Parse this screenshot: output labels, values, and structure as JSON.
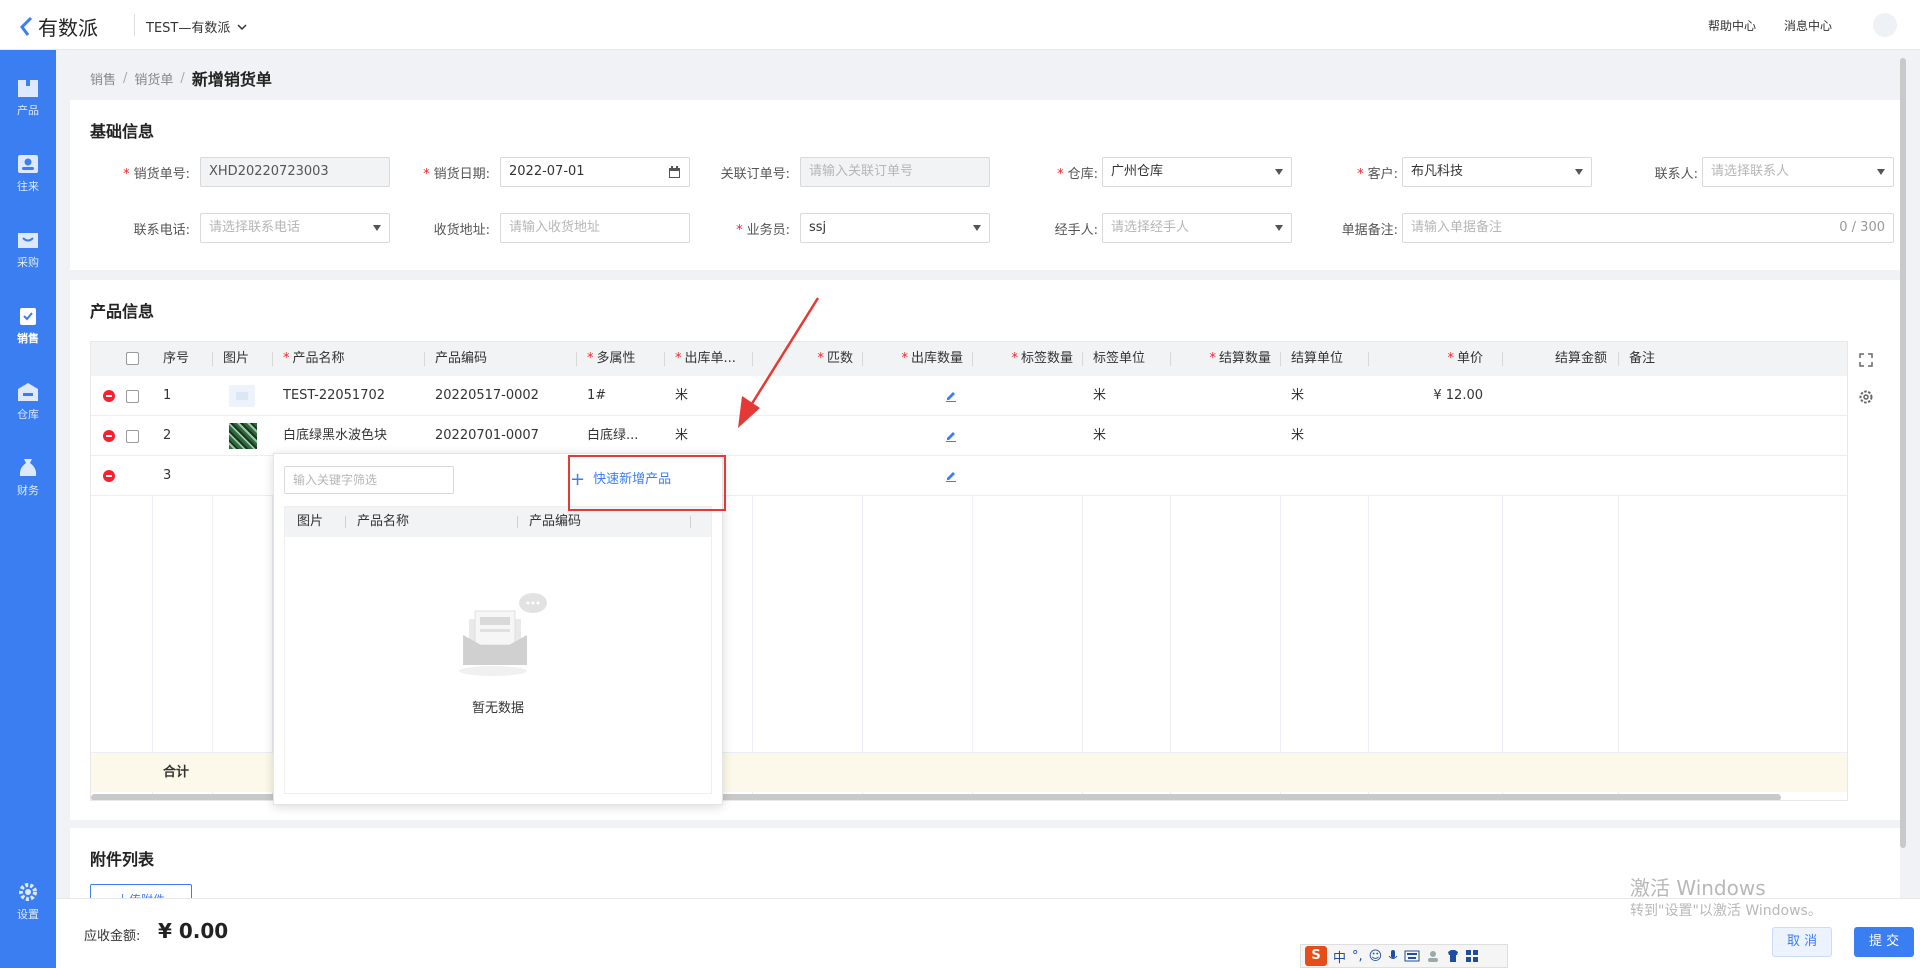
{
  "header": {
    "logo_text": "有数派",
    "company": "TEST—有数派",
    "help_center": "帮助中心",
    "message_center": "消息中心"
  },
  "nav": {
    "items": [
      {
        "label": "产品",
        "icon": "box-icon"
      },
      {
        "label": "往来",
        "icon": "contact-icon"
      },
      {
        "label": "采购",
        "icon": "cart-icon"
      },
      {
        "label": "销售",
        "icon": "clipboard-icon",
        "active": true
      },
      {
        "label": "仓库",
        "icon": "warehouse-icon"
      },
      {
        "label": "财务",
        "icon": "money-bag-icon"
      }
    ],
    "settings": "设置"
  },
  "breadcrumb": [
    "销售",
    "销货单",
    "新增销货单"
  ],
  "basic": {
    "title": "基础信息",
    "fields": {
      "order_no": {
        "label": "销货单号",
        "required": true,
        "value": "XHD20220723003"
      },
      "date": {
        "label": "销货日期",
        "required": true,
        "value": "2022-07-01"
      },
      "linked_order": {
        "label": "关联订单号",
        "required": false,
        "placeholder": "请输入关联订单号"
      },
      "warehouse": {
        "label": "仓库",
        "required": true,
        "value": "广州仓库"
      },
      "customer": {
        "label": "客户",
        "required": true,
        "value": "布凡科技"
      },
      "contact": {
        "label": "联系人",
        "required": false,
        "placeholder": "请选择联系人"
      },
      "phone": {
        "label": "联系电话",
        "required": false,
        "placeholder": "请选择联系电话"
      },
      "address": {
        "label": "收货地址",
        "required": false,
        "placeholder": "请输入收货地址"
      },
      "salesman": {
        "label": "业务员",
        "required": true,
        "value": "ssj"
      },
      "handler": {
        "label": "经手人",
        "required": false,
        "placeholder": "请选择经手人"
      },
      "remark": {
        "label": "单据备注",
        "required": false,
        "placeholder": "请输入单据备注",
        "counter": "0 / 300"
      }
    }
  },
  "products": {
    "title": "产品信息",
    "columns": [
      {
        "label": "序号",
        "required": false
      },
      {
        "label": "图片",
        "required": false
      },
      {
        "label": "产品名称",
        "required": true
      },
      {
        "label": "产品编码",
        "required": false
      },
      {
        "label": "多属性",
        "required": true
      },
      {
        "label": "出库单...",
        "required": true
      },
      {
        "label": "匹数",
        "required": true
      },
      {
        "label": "出库数量",
        "required": true
      },
      {
        "label": "标签数量",
        "required": true
      },
      {
        "label": "标签单位",
        "required": false
      },
      {
        "label": "结算数量",
        "required": true
      },
      {
        "label": "结算单位",
        "required": false
      },
      {
        "label": "单价",
        "required": true
      },
      {
        "label": "结算金额",
        "required": false
      },
      {
        "label": "备注",
        "required": false
      }
    ],
    "rows": [
      {
        "no": "1",
        "name": "TEST-22051702",
        "code": "20220517-0002",
        "attr": "1#",
        "unit": "米",
        "label_unit": "米",
        "settle_unit": "米",
        "price": "¥ 12.00"
      },
      {
        "no": "2",
        "name": "白底绿黑水波色块",
        "code": "20220701-0007",
        "attr": "白底绿...",
        "unit": "米",
        "label_unit": "米",
        "settle_unit": "米",
        "price": ""
      },
      {
        "no": "3",
        "name": "",
        "code": "",
        "attr": "",
        "unit": "",
        "label_unit": "",
        "settle_unit": "",
        "price": ""
      }
    ],
    "total_label": "合计"
  },
  "dropdown": {
    "search_placeholder": "输入关键字筛选",
    "quick_add": "快速新增产品",
    "columns": [
      "图片",
      "产品名称",
      "产品编码"
    ],
    "empty": "暂无数据"
  },
  "attachments": {
    "title": "附件列表",
    "upload": "上传附件"
  },
  "footer": {
    "receivable_label": "应收金额:",
    "receivable_value": "¥ 0.00",
    "cancel": "取 消",
    "submit": "提 交"
  },
  "watermark": {
    "line1": "激活 Windows",
    "line2": "转到\"设置\"以激活 Windows。"
  },
  "ime": {
    "lang": "中",
    "punct": "°,"
  },
  "colors": {
    "primary": "#3a7ef2",
    "required": "#f5222d",
    "highlight": "#e53935"
  }
}
